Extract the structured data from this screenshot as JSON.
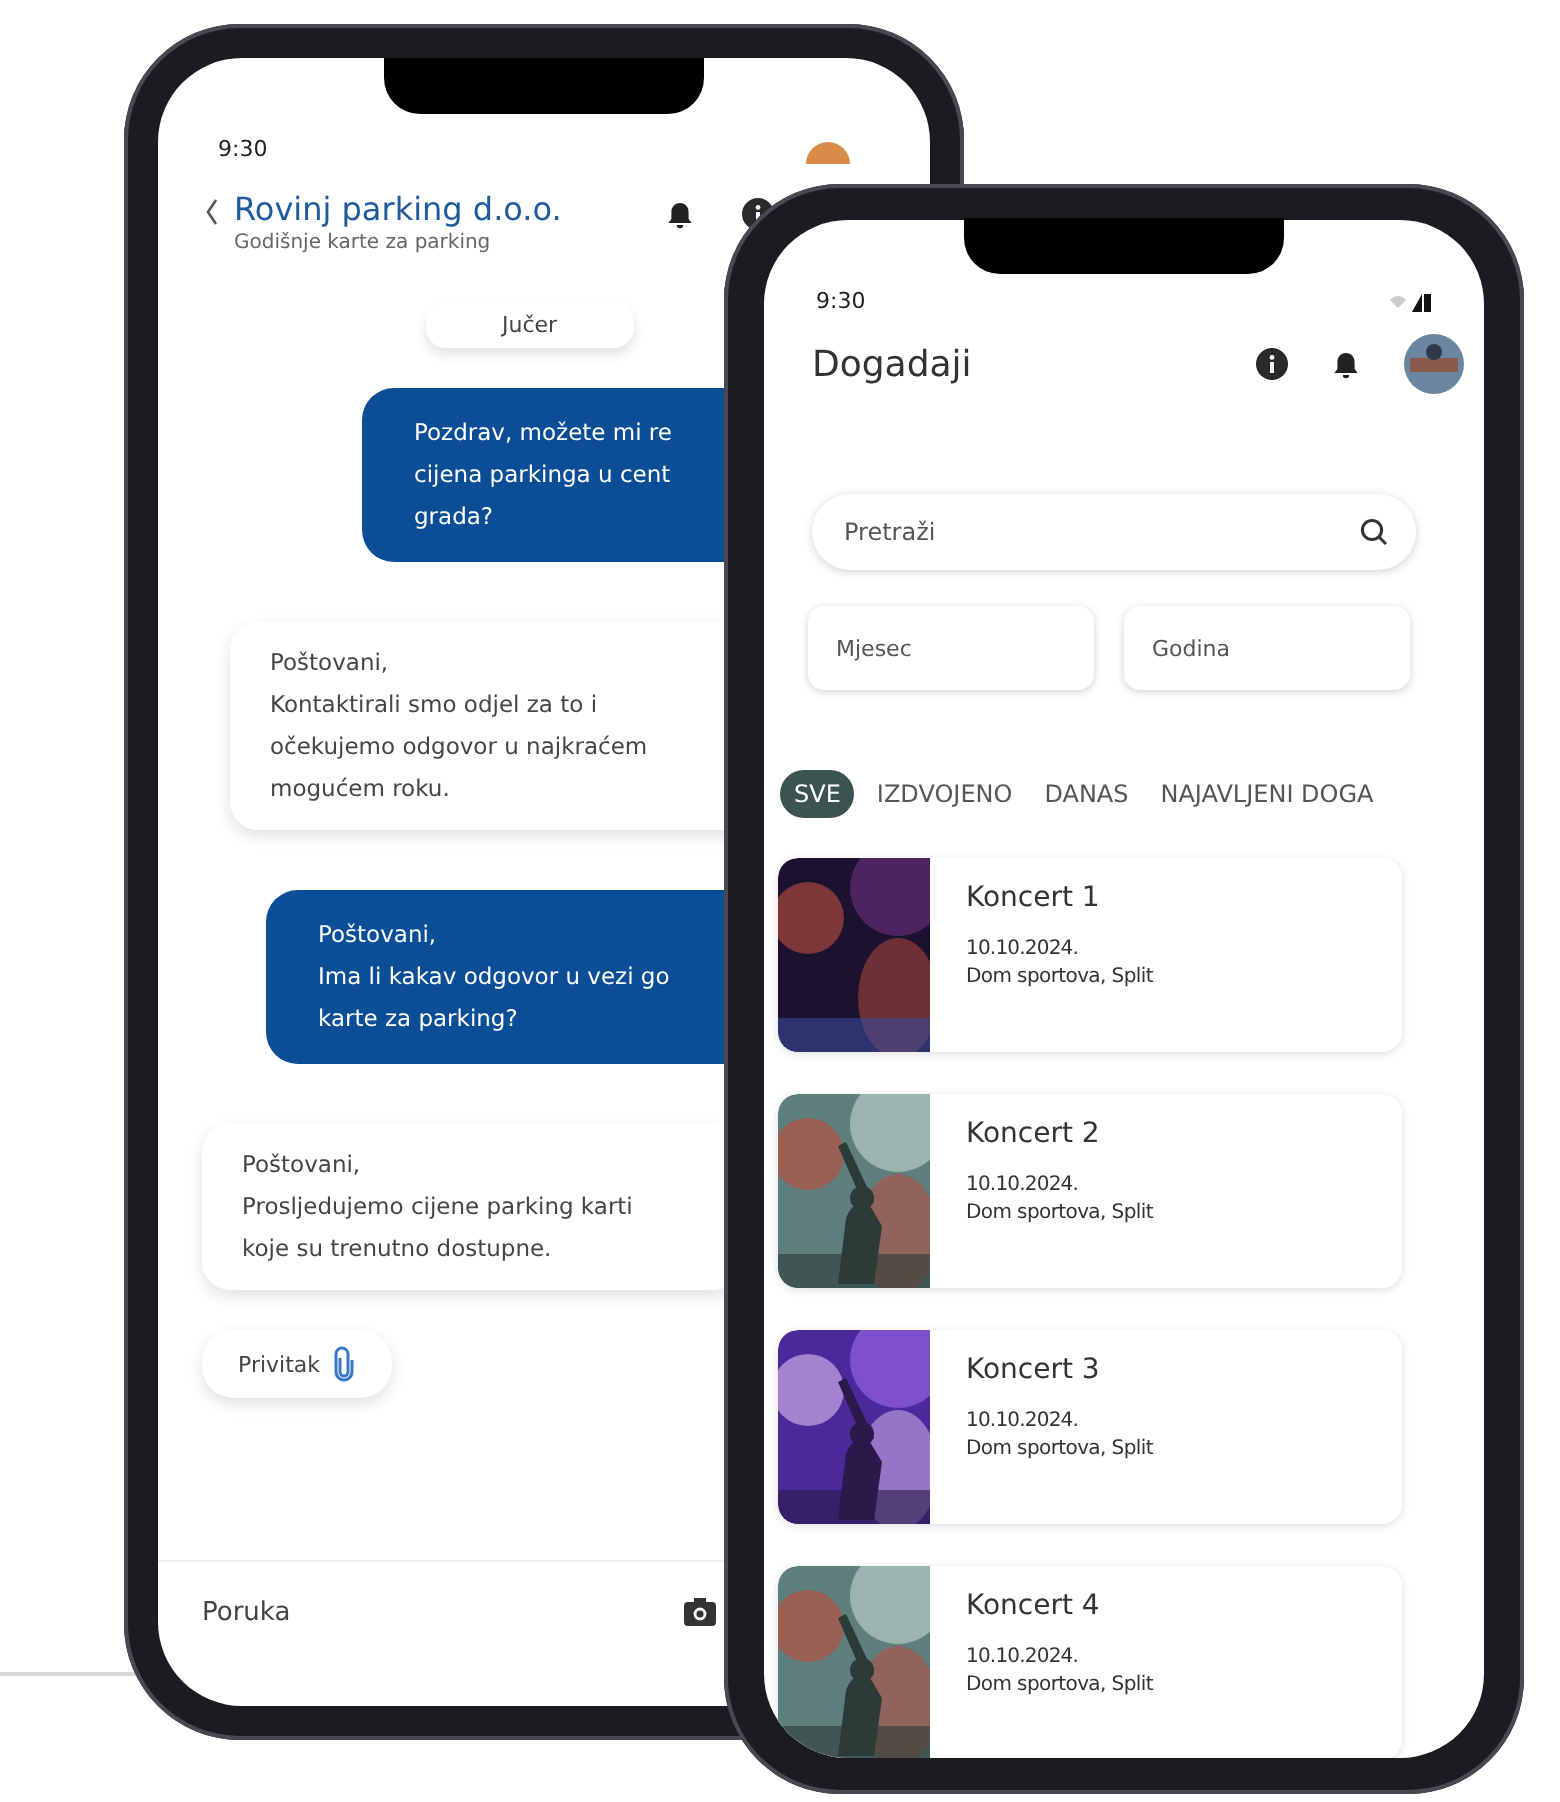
{
  "chat_phone": {
    "status_time": "9:30",
    "header": {
      "title": "Rovinj parking d.o.o.",
      "subtitle": "Godišnje karte za parking"
    },
    "date_chip": "Jučer",
    "messages": [
      {
        "kind": "sent",
        "lines": [
          "Pozdrav, možete mi re",
          "cijena parkinga u cent",
          "grada?"
        ]
      },
      {
        "kind": "received",
        "lines": [
          "Poštovani,",
          "Kontaktirali smo odjel za to i",
          "očekujemo odgovor u najkraćem",
          "mogućem roku."
        ]
      },
      {
        "kind": "sent",
        "lines": [
          "Poštovani,",
          "Ima li kakav odgovor u vezi go",
          "karte za parking?"
        ]
      },
      {
        "kind": "received",
        "lines": [
          "Poštovani,",
          "Prosljedujemo cijene parking karti",
          "koje su trenutno dostupne."
        ]
      }
    ],
    "attachment": {
      "label": "Privitak"
    },
    "composer": {
      "placeholder": "Poruka"
    }
  },
  "events_phone": {
    "status_time": "9:30",
    "title": "Dogadaji",
    "search": {
      "placeholder": "Pretraži"
    },
    "filters": [
      {
        "placeholder": "Mjesec"
      },
      {
        "placeholder": "Godina"
      }
    ],
    "tabs": [
      {
        "label": "SVE",
        "selected": true
      },
      {
        "label": "IZDVOJENO",
        "selected": false
      },
      {
        "label": "DANAS",
        "selected": false
      },
      {
        "label": "NAJAVLJENI DOGA",
        "selected": false
      }
    ],
    "events": [
      {
        "title": "Koncert 1",
        "date": "10.10.2024.",
        "venue": "Dom sportova, Split"
      },
      {
        "title": "Koncert 2",
        "date": "10.10.2024.",
        "venue": "Dom sportova, Split"
      },
      {
        "title": "Koncert 3",
        "date": "10.10.2024.",
        "venue": "Dom sportova, Split"
      },
      {
        "title": "Koncert 4",
        "date": "10.10.2024.",
        "venue": "Dom sportova, Split"
      }
    ]
  }
}
